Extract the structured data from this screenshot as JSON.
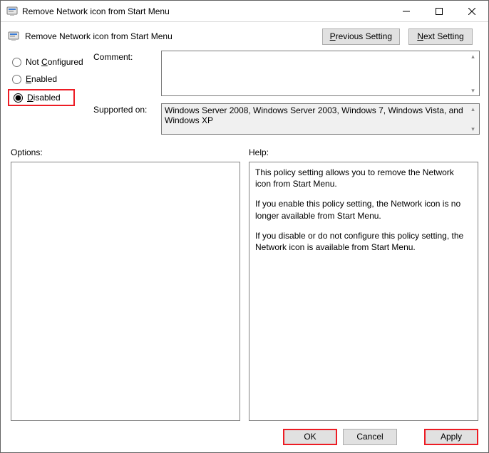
{
  "window": {
    "title": "Remove Network icon from Start Menu",
    "subtitle": "Remove Network icon from Start Menu"
  },
  "nav": {
    "previous": "Previous Setting",
    "next": "Next Setting"
  },
  "radios": {
    "not_configured": "Not Configured",
    "enabled": "Enabled",
    "disabled": "Disabled",
    "selected": "disabled"
  },
  "fields": {
    "comment_label": "Comment:",
    "comment_value": "",
    "supported_label": "Supported on:",
    "supported_value": "Windows Server 2008, Windows Server 2003, Windows 7, Windows Vista, and Windows XP"
  },
  "columns": {
    "options_label": "Options:",
    "help_label": "Help:"
  },
  "help": {
    "p1": "This policy setting allows you to remove the Network icon from Start Menu.",
    "p2": "If you enable this policy setting, the Network icon is no longer available from Start Menu.",
    "p3": "If you disable or do not configure this policy setting, the Network icon is available from Start Menu."
  },
  "footer": {
    "ok": "OK",
    "cancel": "Cancel",
    "apply": "Apply"
  }
}
